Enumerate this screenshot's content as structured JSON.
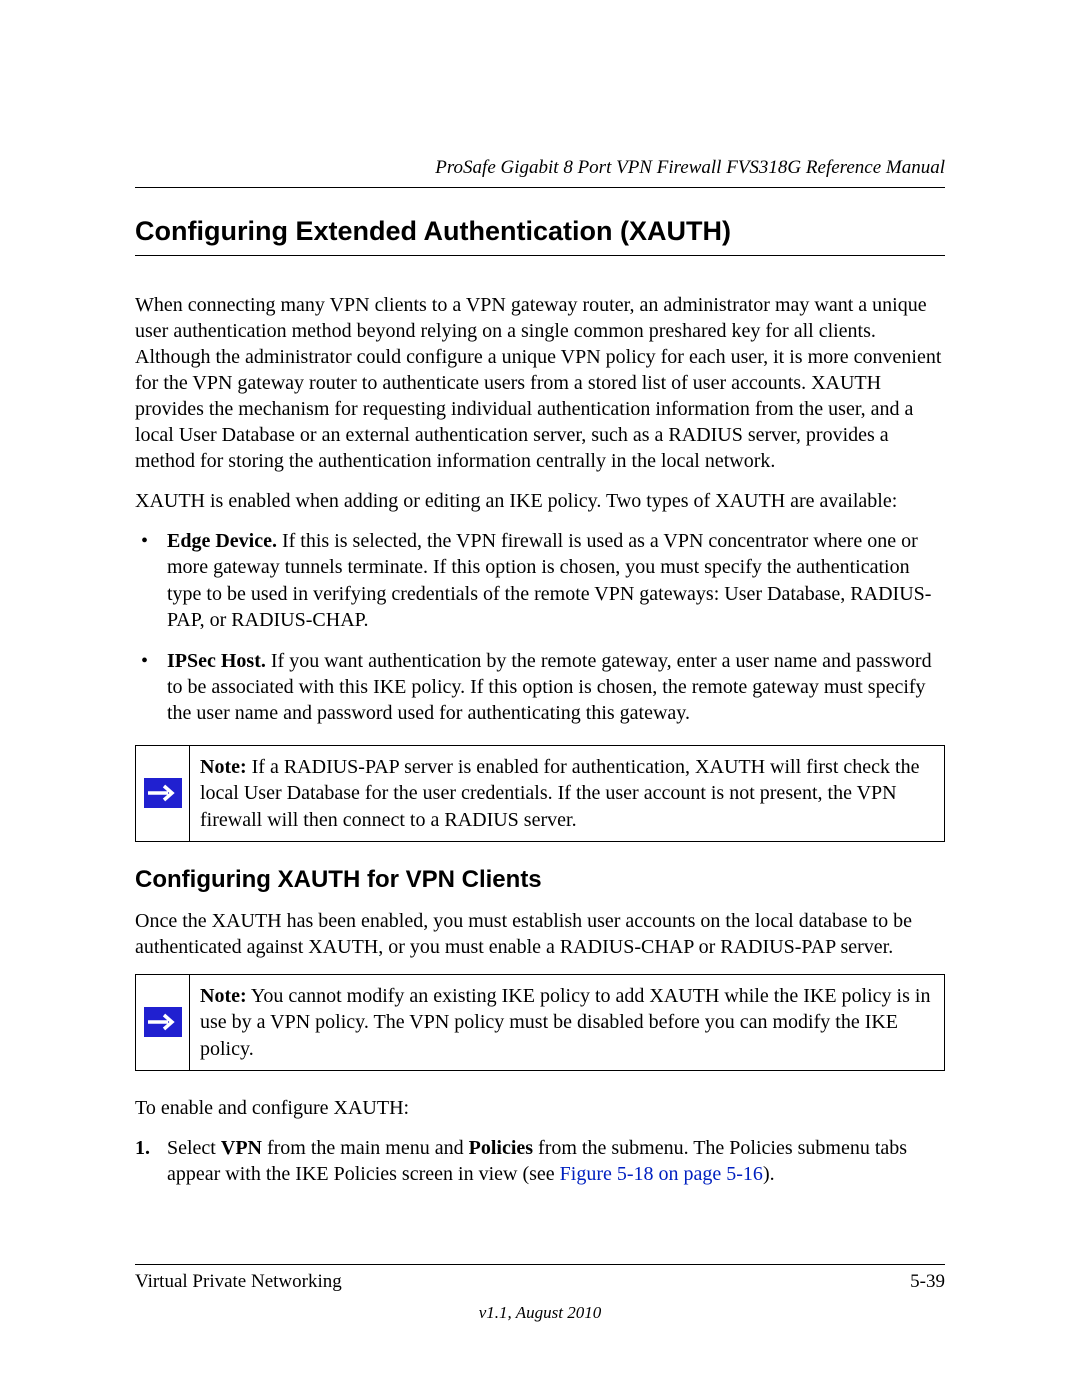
{
  "header": {
    "running": "ProSafe Gigabit 8 Port VPN Firewall FVS318G Reference Manual"
  },
  "section": {
    "h1": "Configuring Extended Authentication (XAUTH)",
    "para1": "When connecting many VPN clients to a VPN gateway router, an administrator may want a unique user authentication method beyond relying on a single common preshared key for all clients. Although the administrator could configure a unique VPN policy for each user, it is more convenient for the VPN gateway router to authenticate users from a stored list of user accounts. XAUTH provides the mechanism for requesting individual authentication information from the user, and a local User Database or an external authentication server, such as a RADIUS server, provides a method for storing the authentication information centrally in the local network.",
    "para2": "XAUTH is enabled when adding or editing an IKE policy. Two types of XAUTH are available:",
    "bullets": [
      {
        "lead": "Edge Device.",
        "rest": " If this is selected, the VPN firewall is used as a VPN concentrator where one or more gateway tunnels terminate. If this option is chosen, you must specify the authentication type to be used in verifying credentials of the remote VPN gateways: User Database, RADIUS-PAP, or RADIUS-CHAP."
      },
      {
        "lead": "IPSec Host.",
        "rest": " If you want authentication by the remote gateway, enter a user name and password to be associated with this IKE policy. If this option is chosen, the remote gateway must specify the user name and password used for authenticating this gateway."
      }
    ],
    "note1": {
      "lead": "Note:",
      "rest": " If a RADIUS-PAP server is enabled for authentication, XAUTH will first check the local User Database for the user credentials. If the user account is not present, the VPN firewall will then connect to a RADIUS server."
    },
    "h2": "Configuring XAUTH for VPN Clients",
    "para3": "Once the XAUTH has been enabled, you must establish user accounts on the local database to be authenticated against XAUTH, or you must enable a RADIUS-CHAP or RADIUS-PAP server.",
    "note2": {
      "lead": "Note:",
      "rest": " You cannot modify an existing IKE policy to add XAUTH while the IKE policy is in use by a VPN policy. The VPN policy must be disabled before you can modify the IKE policy."
    },
    "para4": "To enable and configure XAUTH:",
    "step1": {
      "num": "1.",
      "t1": "Select ",
      "b1": "VPN",
      "t2": " from the main menu and ",
      "b2": "Policies",
      "t3": " from the submenu. The Policies submenu tabs appear with the IKE Policies screen in view (see ",
      "link": "Figure 5-18 on page 5-16",
      "t4": ")."
    }
  },
  "footer": {
    "left": "Virtual Private Networking",
    "right": "5-39",
    "version": "v1.1, August 2010"
  }
}
